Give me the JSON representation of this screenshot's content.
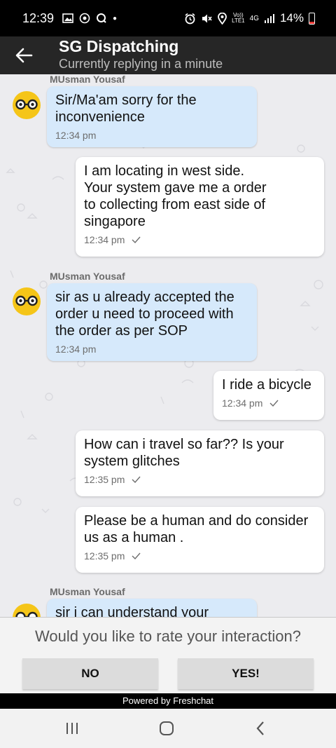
{
  "status_bar": {
    "time": "12:39",
    "network": "4G",
    "volte": "Vo))\nLTE1",
    "battery_percent": "14%",
    "battery_level": 0.14,
    "battery_color": "#e53935"
  },
  "header": {
    "title": "SG Dispatching",
    "subtitle": "Currently replying in a minute",
    "back_icon": "arrow-left-icon"
  },
  "messages": [
    {
      "direction": "in",
      "sender": "",
      "text": "Sir/Ma'am sorry for the inconvenience",
      "lines": [
        "Sir/Ma'am sorry for the",
        "inconvenience"
      ],
      "time": "12:34 pm"
    },
    {
      "direction": "out",
      "lines": [
        "I am locating in west side.",
        "Your system gave me a order",
        "to collecting from east side of",
        "singapore"
      ],
      "time": "12:34 pm"
    },
    {
      "direction": "in",
      "sender": "MUsman Yousaf",
      "lines": [
        "sir as u already accepted the",
        "order u need to proceed with",
        "the order as per SOP"
      ],
      "time": "12:34 pm"
    },
    {
      "direction": "out",
      "lines": [
        "I ride a bicycle"
      ],
      "time": "12:34 pm"
    },
    {
      "direction": "out",
      "lines": [
        "How can i travel so far?? Is your",
        "system glitches"
      ],
      "time": "12:35 pm"
    },
    {
      "direction": "out",
      "lines": [
        "Please be a human and do consider",
        "us as a human ."
      ],
      "time": "12:35 pm"
    },
    {
      "direction": "in",
      "sender": "MUsman Yousaf",
      "lines": [
        "sir i can understand your"
      ],
      "time": ""
    }
  ],
  "top_sender_partial": "MUsman Yousaf",
  "rating": {
    "question": "Would you like to rate your interaction?",
    "no_label": "NO",
    "yes_label": "YES!"
  },
  "footer": {
    "powered_by": "Powered by Freshchat"
  },
  "colors": {
    "incoming_bubble": "#d6e9fb",
    "outgoing_bubble": "#ffffff",
    "header_bg": "#262626",
    "avatar_yellow": "#f5c518"
  }
}
